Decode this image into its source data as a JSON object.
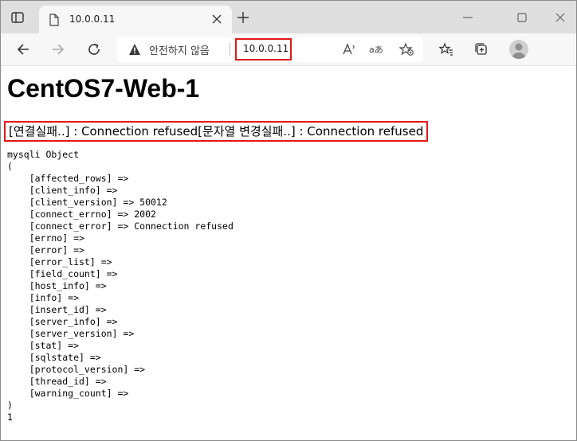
{
  "browser": {
    "tab_title": "10.0.0.11",
    "security_label": "안전하지 않음",
    "url": "10.0.0.11"
  },
  "page": {
    "heading": "CentOS7-Web-1",
    "status_text": "[연결실패..] : Connection refused[문자열 변경실패..] : Connection refused",
    "dump_lines": [
      "mysqli Object",
      "(",
      "    [affected_rows] =>",
      "    [client_info] =>",
      "    [client_version] => 50012",
      "    [connect_errno] => 2002",
      "    [connect_error] => Connection refused",
      "    [errno] =>",
      "    [error] =>",
      "    [error_list] =>",
      "    [field_count] =>",
      "    [host_info] =>",
      "    [info] =>",
      "    [insert_id] =>",
      "    [server_info] =>",
      "    [server_version] =>",
      "    [stat] =>",
      "    [sqlstate] =>",
      "    [protocol_version] =>",
      "    [thread_id] =>",
      "    [warning_count] =>",
      ")",
      "1"
    ]
  },
  "colors": {
    "highlight_border": "#e01818",
    "tabstrip": "#dfdfdf",
    "toolbar": "#f7f7f7"
  },
  "icons": {
    "tab_actions": "tab-actions-icon",
    "page": "page-icon",
    "close_tab": "close-icon",
    "new_tab": "plus-icon",
    "minimize": "minimize-icon",
    "maximize": "maximize-icon",
    "close_window": "close-icon",
    "back": "back-arrow-icon",
    "forward": "forward-arrow-icon",
    "refresh": "refresh-icon",
    "not_secure": "warning-icon",
    "read_aloud": "read-aloud-icon",
    "translate": "translate-icon",
    "add_favorite": "star-plus-icon",
    "favorites": "favorites-icon",
    "collections": "collections-icon",
    "profile": "profile-avatar"
  }
}
